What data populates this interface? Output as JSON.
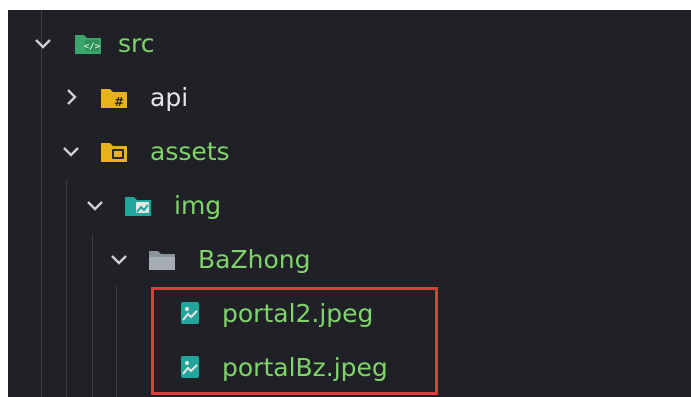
{
  "explorer": {
    "tree": [
      {
        "label": "src",
        "expanded": true,
        "icon": "folder-src-icon",
        "color": "#7fd36a"
      },
      {
        "label": "api",
        "expanded": false,
        "icon": "folder-api-icon",
        "color": "#e6e6e6"
      },
      {
        "label": "assets",
        "expanded": true,
        "icon": "folder-assets-icon",
        "color": "#7fd36a"
      },
      {
        "label": "img",
        "expanded": true,
        "icon": "folder-images-icon",
        "color": "#7fd36a"
      },
      {
        "label": "BaZhong",
        "expanded": true,
        "icon": "folder-icon",
        "color": "#7fd36a"
      },
      {
        "label": "portal2.jpeg",
        "type": "file",
        "icon": "image-file-icon",
        "color": "#7fd36a"
      },
      {
        "label": "portalBz.jpeg",
        "type": "file",
        "icon": "image-file-icon",
        "color": "#7fd36a"
      }
    ]
  },
  "colors": {
    "background": "#1f2127",
    "highlight_border": "#e23b3b",
    "label_default": "#e6e6e6",
    "label_git": "#7fd36a"
  }
}
